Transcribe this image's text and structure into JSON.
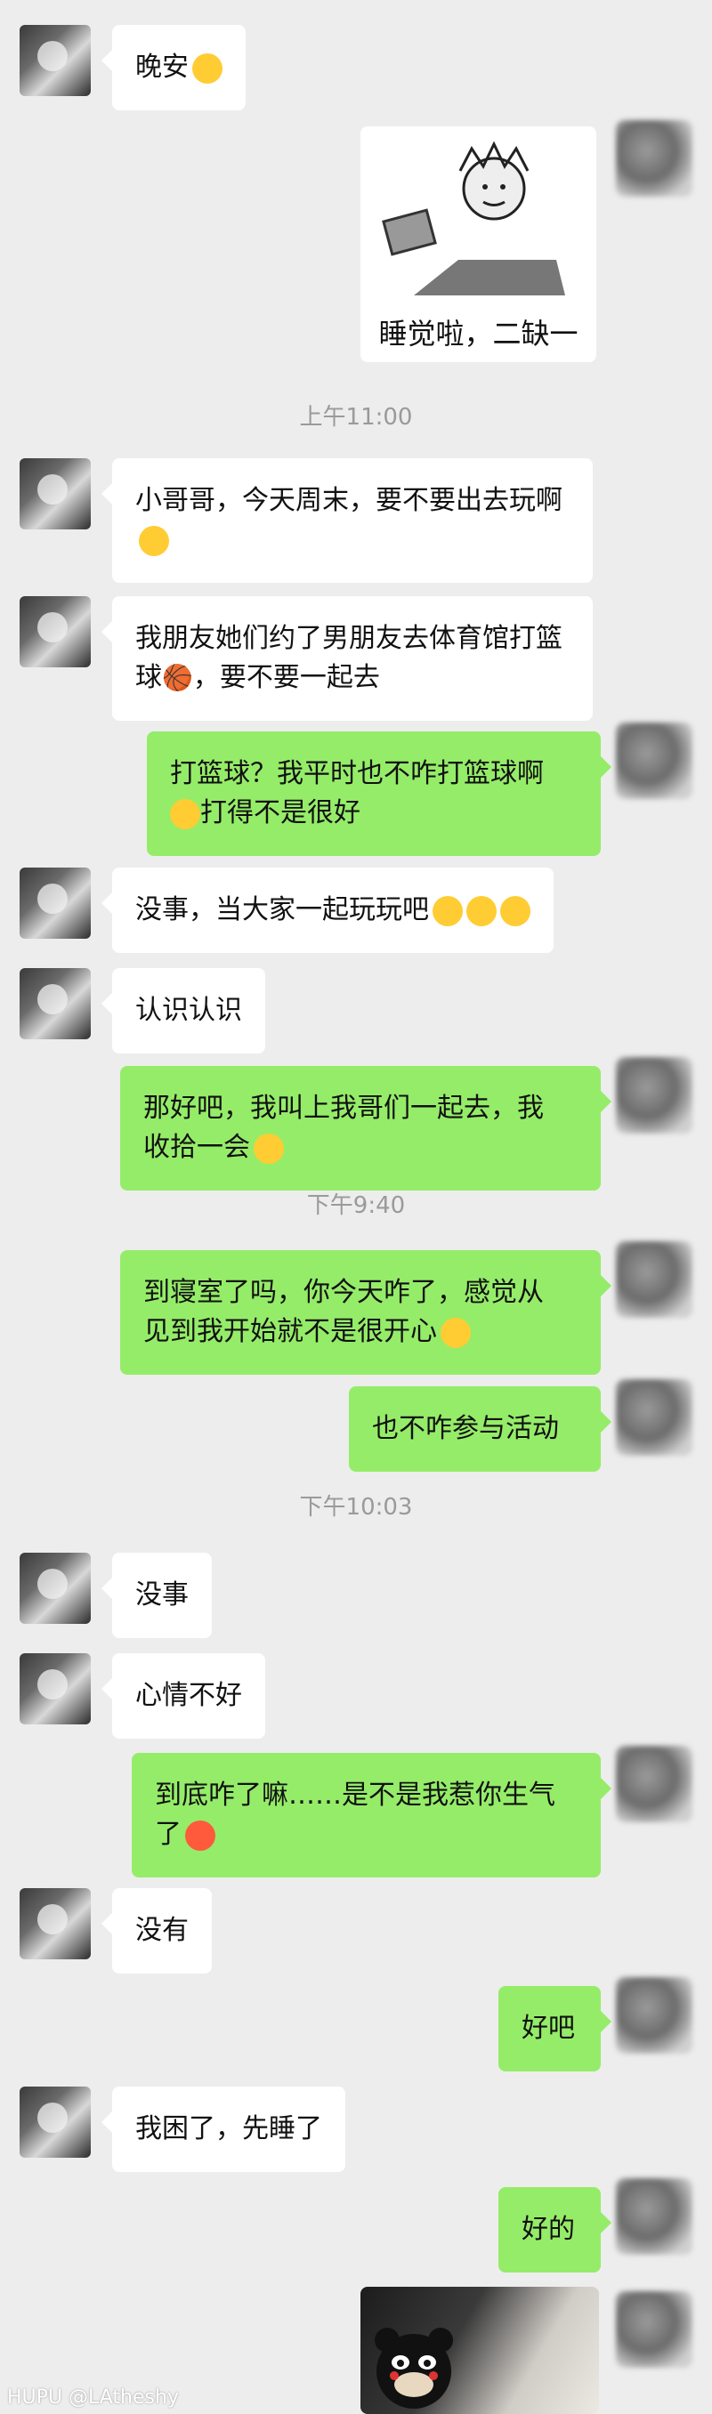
{
  "messages": {
    "m1": "晚安",
    "sticker_caption": "睡觉啦，二缺一",
    "m2": "小哥哥，今天周末，要不要出去玩啊",
    "m3": "我朋友她们约了男朋友去体育馆打篮球",
    "m3b": "，要不要一起去",
    "m4a": "打篮球？我平时也不咋打篮球啊",
    "m4b": "打得不是很好",
    "m5": "没事，当大家一起玩玩吧",
    "m6": "认识认识",
    "m7a": "那好吧，我叫上我哥们一起去，我",
    "m7b": "收拾一会",
    "m8a": "到寝室了吗，你今天咋了，感觉从",
    "m8b": "见到我开始就不是很开心",
    "m9": "也不咋参与活动",
    "m10": "没事",
    "m11": "心情不好",
    "m12a": "到底咋了嘛……是不是我惹你生气",
    "m12b": "了",
    "m13": "没有",
    "m14": "好吧",
    "m15": "我困了，先睡了",
    "m16": "好的"
  },
  "times": {
    "t1": "上午11:00",
    "t2": "下午9:40",
    "t3": "下午10:03"
  },
  "watermark": "HUPU @LAtheshy",
  "colors": {
    "background": "#ededed",
    "bubble_self": "#95ec69",
    "bubble_other": "#ffffff"
  }
}
